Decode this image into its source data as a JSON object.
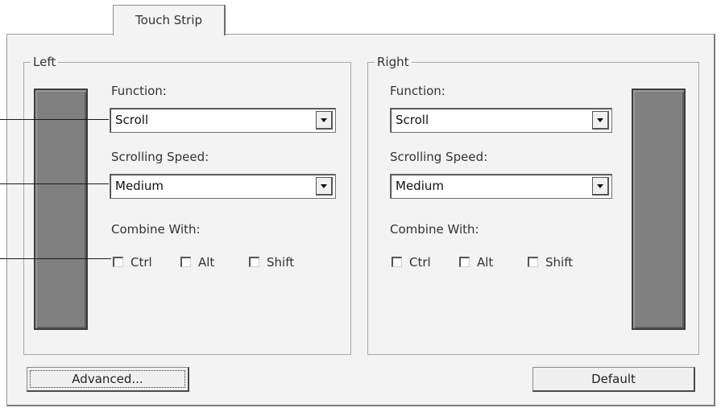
{
  "tab": {
    "label": "Touch Strip"
  },
  "left": {
    "group_label": "Left",
    "function_label": "Function:",
    "function_value": "Scroll",
    "speed_label": "Scrolling Speed:",
    "speed_value": "Medium",
    "combine_label": "Combine With:",
    "modifiers": [
      {
        "label": "Ctrl",
        "checked": false
      },
      {
        "label": "Alt",
        "checked": false
      },
      {
        "label": "Shift",
        "checked": false
      }
    ]
  },
  "right": {
    "group_label": "Right",
    "function_label": "Function:",
    "function_value": "Scroll",
    "speed_label": "Scrolling Speed:",
    "speed_value": "Medium",
    "combine_label": "Combine With:",
    "modifiers": [
      {
        "label": "Ctrl",
        "checked": false
      },
      {
        "label": "Alt",
        "checked": false
      },
      {
        "label": "Shift",
        "checked": false
      }
    ]
  },
  "buttons": {
    "advanced": "Advanced...",
    "default": "Default"
  },
  "icons": {
    "dropdown": "chevron-down-icon",
    "checkbox": "checkbox-icon"
  }
}
